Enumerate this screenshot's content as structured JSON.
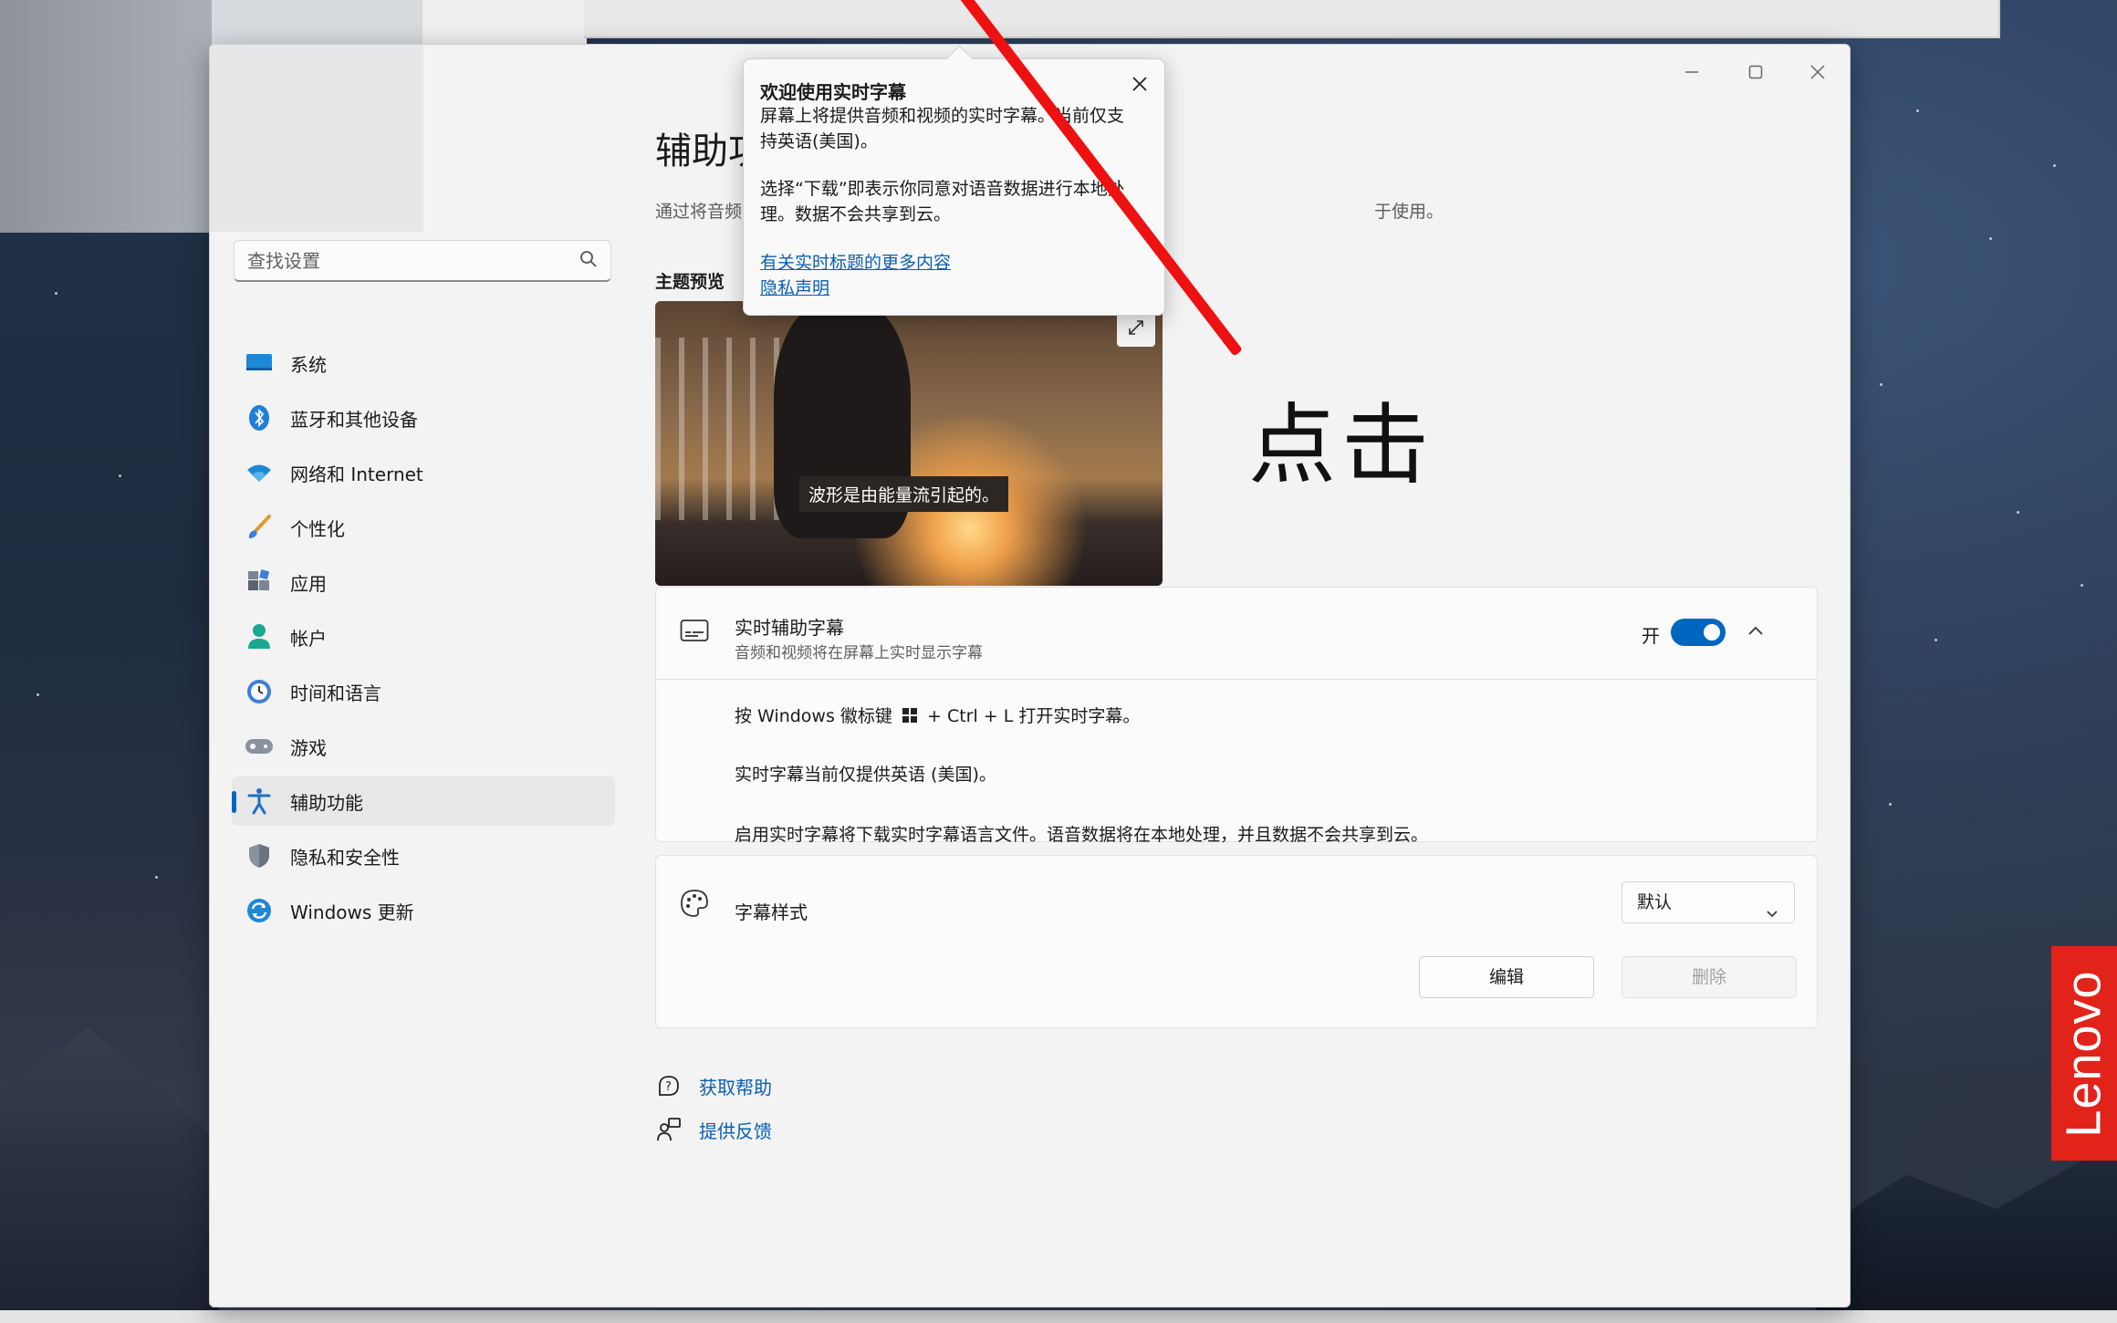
{
  "page": {
    "title": "辅助功",
    "description": "通过将音频",
    "description_tail": "于使用。",
    "preview_label": "主题预览",
    "preview_caption": "波形是由能量流引起的。"
  },
  "search": {
    "placeholder": "查找设置"
  },
  "nav": {
    "items": [
      {
        "label": "系统",
        "icon": "system-icon"
      },
      {
        "label": "蓝牙和其他设备",
        "icon": "bluetooth-icon"
      },
      {
        "label": "网络和 Internet",
        "icon": "wifi-icon"
      },
      {
        "label": "个性化",
        "icon": "brush-icon"
      },
      {
        "label": "应用",
        "icon": "apps-icon"
      },
      {
        "label": "帐户",
        "icon": "account-icon"
      },
      {
        "label": "时间和语言",
        "icon": "clock-globe-icon"
      },
      {
        "label": "游戏",
        "icon": "gamepad-icon"
      },
      {
        "label": "辅助功能",
        "icon": "accessibility-icon",
        "active": true
      },
      {
        "label": "隐私和安全性",
        "icon": "shield-icon"
      },
      {
        "label": "Windows 更新",
        "icon": "update-icon"
      }
    ]
  },
  "live_captions": {
    "title": "实时辅助字幕",
    "subtitle": "音频和视频将在屏幕上实时显示字幕",
    "toggle_label": "开",
    "line1_a": "按 Windows 徽标键",
    "line1_b": "+ Ctrl + L 打开实时字幕。",
    "line2": "实时字幕当前仅提供英语 (美国)。",
    "line3": "启用实时字幕将下载实时字幕语言文件。语音数据将在本地处理，并且数据不会共享到云。"
  },
  "caption_style": {
    "title": "字幕样式",
    "selected": "默认",
    "edit_label": "编辑",
    "delete_label": "删除"
  },
  "links": {
    "help": "获取帮助",
    "feedback": "提供反馈"
  },
  "flyout": {
    "title": "欢迎使用实时字幕",
    "p1": "屏幕上将提供音频和视频的实时字幕。当前仅支持英语(美国)。",
    "p2": "选择“下载”即表示你同意对语音数据进行本地处理。数据不会共享到云。",
    "link1": "有关实时标题的更多内容",
    "link2": "隐私声明"
  },
  "annotation": {
    "text": "点击",
    "color": "#ee1111"
  },
  "brand": {
    "text": "Lenovo",
    "color": "#e2231a"
  },
  "colors": {
    "accent": "#0067c0",
    "link": "#0a5fb4"
  }
}
